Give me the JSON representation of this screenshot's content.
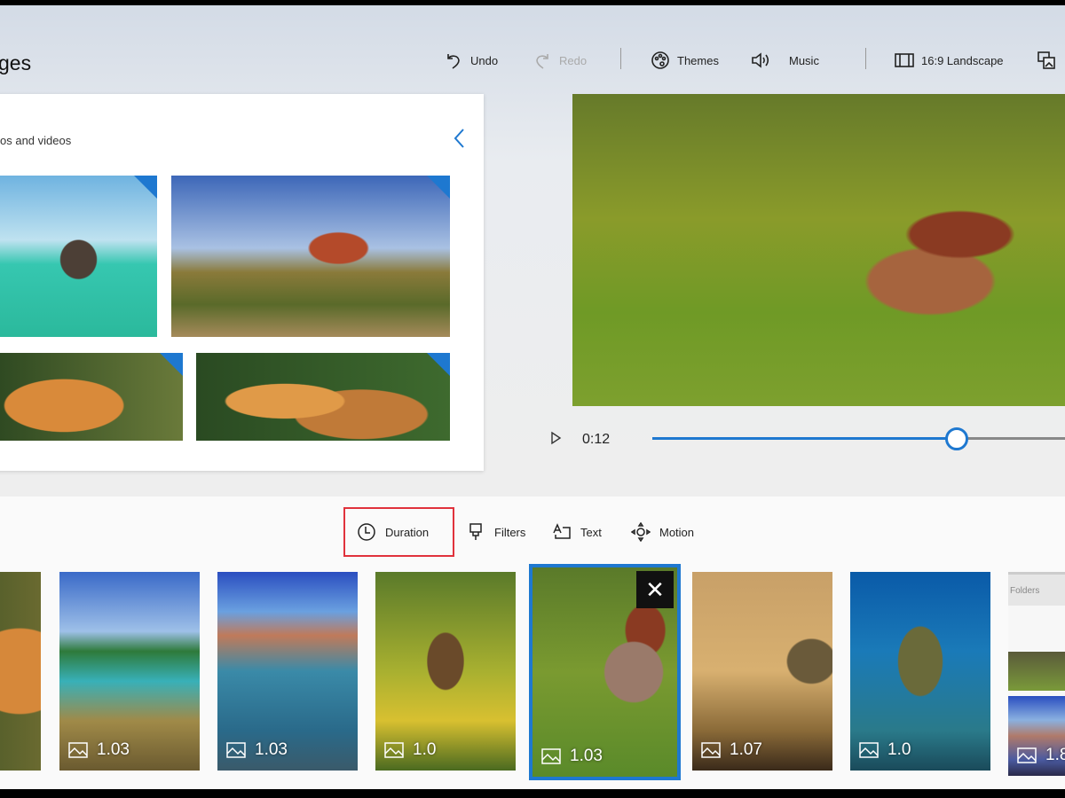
{
  "header": {
    "title": "ges"
  },
  "toolbar": {
    "undo": "Undo",
    "redo": "Redo",
    "themes": "Themes",
    "music": "Music",
    "aspect": "16:9 Landscape"
  },
  "library": {
    "heading": "os and videos"
  },
  "player": {
    "time": "0:12",
    "progress": 0.66
  },
  "edit_tools": {
    "duration": "Duration",
    "filters": "Filters",
    "text": "Text",
    "motion": "Motion"
  },
  "storyboard": {
    "durations": [
      "1.03",
      "1.03",
      "1.0",
      "1.03",
      "1.07",
      "1.0",
      "1.8"
    ],
    "remove": "✕"
  },
  "side_panel": {
    "folders": "Folders"
  },
  "colors": {
    "accent": "#1e78d0",
    "highlight": "#e0323c"
  }
}
